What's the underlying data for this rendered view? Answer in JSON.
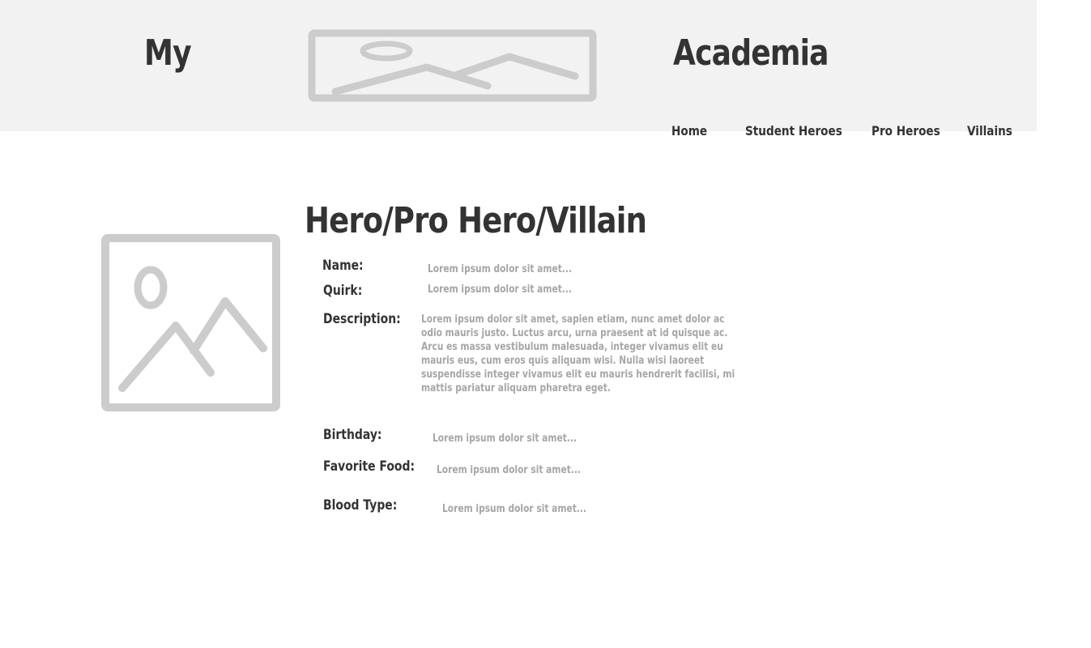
{
  "header": {
    "brand_left": "My",
    "brand_right": "Academia",
    "logo_icon": "image-placeholder-icon",
    "background": "#f2f2f2"
  },
  "nav": {
    "items": [
      {
        "label": "Home"
      },
      {
        "label": "Student Heroes"
      },
      {
        "label": "Pro Heroes"
      },
      {
        "label": "Villains"
      }
    ]
  },
  "profile": {
    "image_icon": "image-placeholder-icon",
    "title": "Hero/Pro Hero/Villain",
    "fields": {
      "name": {
        "label": "Name:",
        "value": "Lorem ipsum dolor sit amet..."
      },
      "quirk": {
        "label": "Quirk:",
        "value": "Lorem ipsum dolor sit amet..."
      },
      "description": {
        "label": "Description:",
        "value": "Lorem ipsum dolor sit amet, sapien etiam, nunc amet dolor ac odio mauris justo. Luctus arcu, urna praesent at id quisque ac. Arcu es massa vestibulum malesuada, integer vivamus elit eu mauris eus, cum eros quis aliquam wisi. Nulla wisi laoreet suspendisse integer vivamus elit eu mauris hendrerit facilisi, mi mattis pariatur aliquam pharetra eget."
      },
      "birthday": {
        "label": "Birthday:",
        "value": "Lorem ipsum dolor sit amet..."
      },
      "favorite_food": {
        "label": "Favorite Food:",
        "value": "Lorem ipsum dolor sit amet..."
      },
      "blood_type": {
        "label": "Blood Type:",
        "value": "Lorem ipsum dolor sit amet..."
      }
    }
  },
  "colors": {
    "text_dark": "#333333",
    "placeholder_gray": "#cccccc",
    "value_gray": "#a6a6a6"
  }
}
